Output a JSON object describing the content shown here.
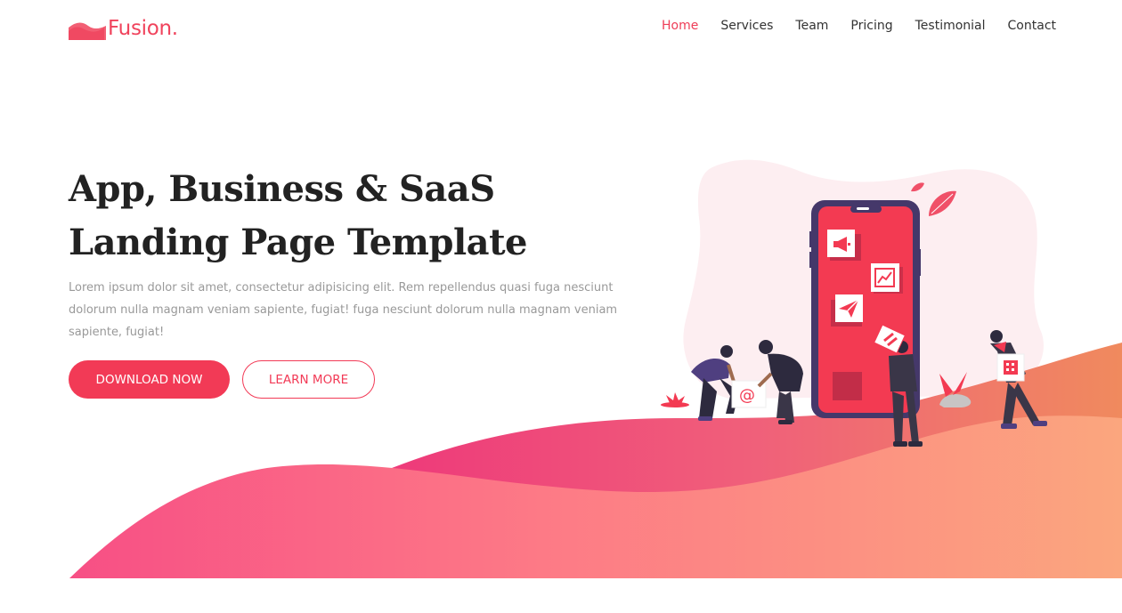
{
  "brand": {
    "name": "Fusion.",
    "logo_icon": "wave-logo-icon",
    "color": "#f0435c"
  },
  "nav": {
    "items": [
      {
        "label": "Home",
        "active": true
      },
      {
        "label": "Services",
        "active": false
      },
      {
        "label": "Team",
        "active": false
      },
      {
        "label": "Pricing",
        "active": false
      },
      {
        "label": "Testimonial",
        "active": false
      },
      {
        "label": "Contact",
        "active": false
      }
    ]
  },
  "hero": {
    "title_line1": "App, Business & SaaS",
    "title_line2": "Landing Page Template",
    "description": "Lorem ipsum dolor sit amet, consectetur adipisicing elit. Rem repellendus quasi fuga nesciunt dolorum nulla magnam veniam sapiente, fugiat! fuga nesciunt dolorum nulla magnam veniam sapiente, fugiat!",
    "primary_button": "DOWNLOAD NOW",
    "secondary_button": "LEARN MORE"
  },
  "illustration": {
    "phone_icons": [
      "megaphone-icon",
      "chart-icon",
      "paper-plane-icon"
    ],
    "email_symbol": "@"
  },
  "colors": {
    "accent": "#f23a56",
    "wave_start": "#f2467f",
    "wave_end": "#fba67e",
    "blob": "#fdeef1",
    "heading": "#222222",
    "body_text": "#999999"
  }
}
